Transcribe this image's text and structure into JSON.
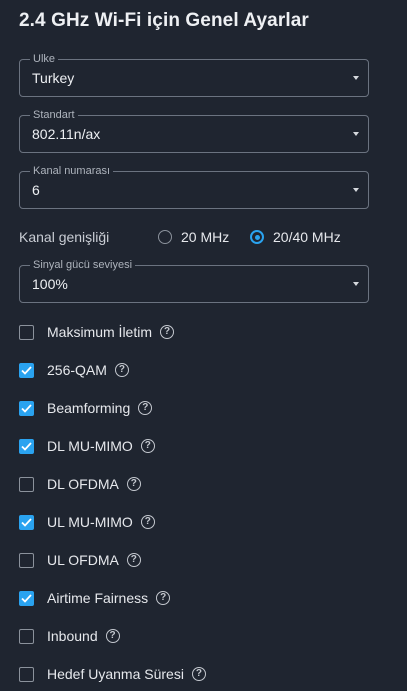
{
  "title": "2.4 GHz Wi-Fi için Genel Ayarlar",
  "fields": {
    "country": {
      "label": "Ulke",
      "value": "Turkey"
    },
    "standard": {
      "label": "Standart",
      "value": "802.11n/ax"
    },
    "channel": {
      "label": "Kanal numarası",
      "value": "6"
    },
    "signal": {
      "label": "Sinyal gücü seviyesi",
      "value": "100%"
    }
  },
  "bandwidth": {
    "label": "Kanal genişliği",
    "options": [
      "20 MHz",
      "20/40 MHz"
    ],
    "selected": "20/40 MHz"
  },
  "options": [
    {
      "label": "Maksimum İletim",
      "checked": false
    },
    {
      "label": "256-QAM",
      "checked": true
    },
    {
      "label": "Beamforming",
      "checked": true
    },
    {
      "label": "DL MU-MIMO",
      "checked": true
    },
    {
      "label": "DL OFDMA",
      "checked": false
    },
    {
      "label": "UL MU-MIMO",
      "checked": true
    },
    {
      "label": "UL OFDMA",
      "checked": false
    },
    {
      "label": "Airtime Fairness",
      "checked": true
    },
    {
      "label": "Inbound",
      "checked": false
    },
    {
      "label": "Hedef Uyanma Süresi",
      "checked": false
    }
  ],
  "help_symbol": "?",
  "colors": {
    "accent": "#2aa3f0",
    "background": "#1f2530"
  },
  "icons": {
    "dropdown": "caret-down-icon",
    "help": "help-circle-icon",
    "check": "checkmark-icon"
  }
}
